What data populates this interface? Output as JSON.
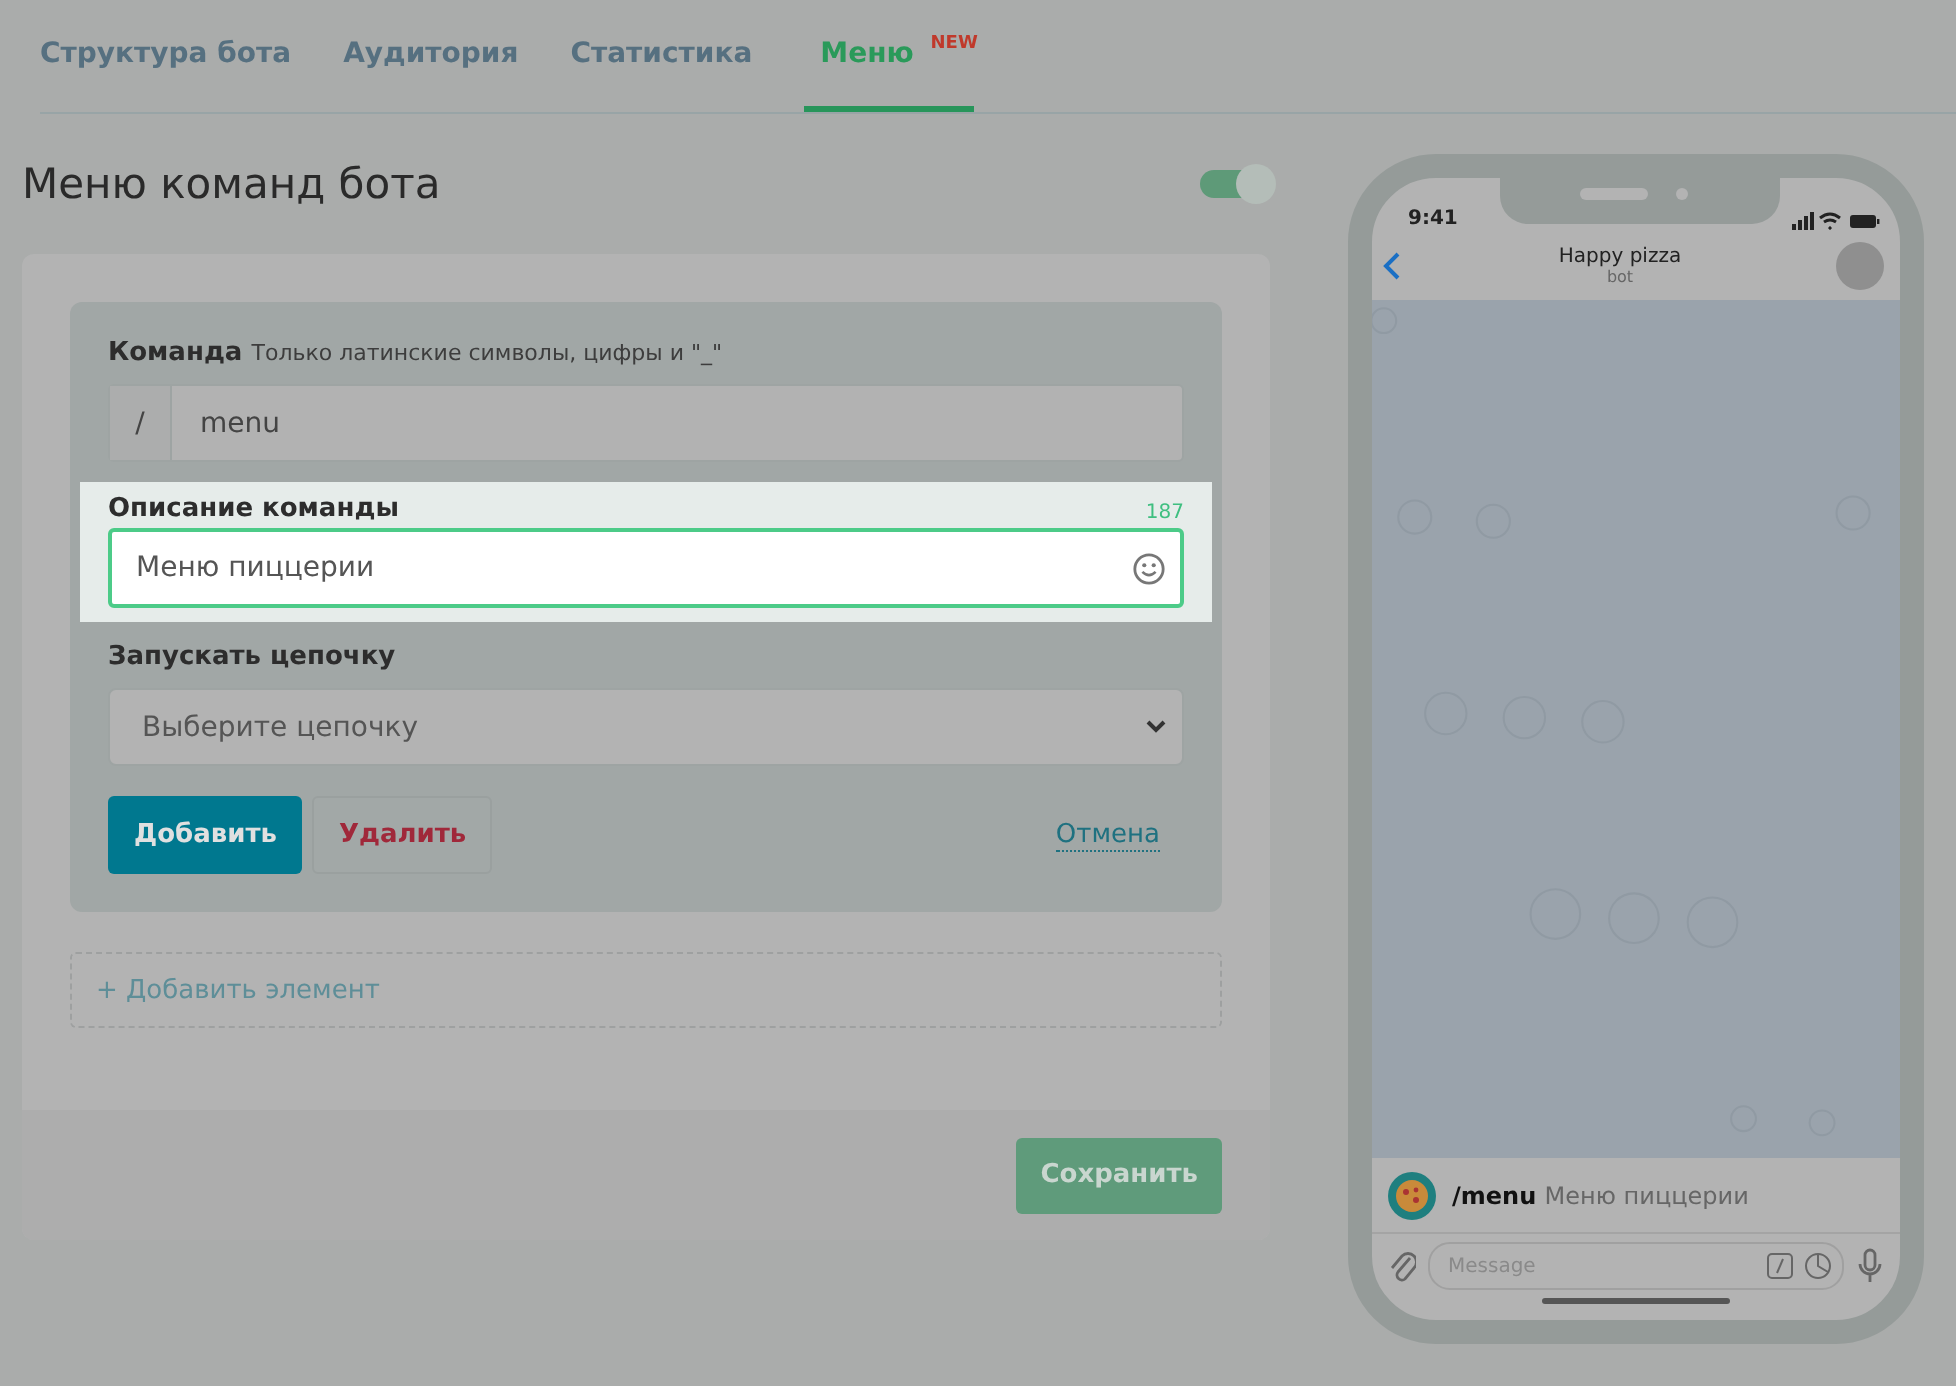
{
  "tabs": [
    {
      "label": "Структура бота",
      "selected": false
    },
    {
      "label": "Аудитория",
      "selected": false
    },
    {
      "label": "Статистика",
      "selected": false
    },
    {
      "label": "Меню",
      "badge": "NEW",
      "selected": true
    }
  ],
  "header": {
    "title": "Меню команд бота",
    "toggle": {
      "on": true
    }
  },
  "form": {
    "command": {
      "label": "Команда",
      "hint": "Только латинские символы, цифры и \"_\"",
      "prefix": "/",
      "value": "menu"
    },
    "description": {
      "label": "Описание команды",
      "counter": "187",
      "value": "Меню пиццерии",
      "highlighted": true
    },
    "chain": {
      "label": "Запускать цепочку",
      "placeholder": "Выберите цепочку"
    },
    "buttons": {
      "add": "Добавить",
      "delete": "Удалить",
      "cancel": "Отмена"
    }
  },
  "add_element": "+ Добавить элемент",
  "save": "Сохранить",
  "phone": {
    "time": "9:41",
    "chat_title": "Happy pizza",
    "chat_subtitle": "bot",
    "command": "/menu",
    "command_description": "Меню пиццерии",
    "message_placeholder": "Message"
  }
}
